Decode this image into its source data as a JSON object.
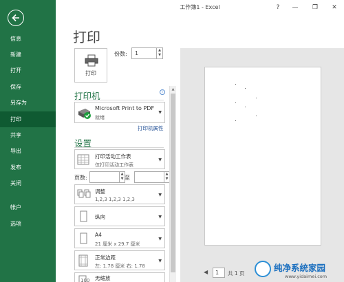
{
  "window": {
    "title": "工作簿1 - Excel",
    "help": "?",
    "minimize": "—",
    "restore": "❐",
    "close": "✕"
  },
  "nav": {
    "items": [
      "信息",
      "新建",
      "打开",
      "保存",
      "另存为",
      "打印",
      "共享",
      "导出",
      "发布",
      "关闭",
      "帐户",
      "选项"
    ],
    "active": "打印"
  },
  "page": {
    "title": "打印"
  },
  "print": {
    "button_label": "打印",
    "copies_label": "份数:",
    "copies_value": "1"
  },
  "printer": {
    "section_title": "打印机",
    "name": "Microsoft Print to PDF",
    "status": "就绪",
    "properties_link": "打印机属性",
    "info": "i"
  },
  "settings": {
    "section_title": "设置",
    "scope": {
      "main": "打印活动工作表",
      "sub": "仅打印活动工作表"
    },
    "pages_label": "页数:",
    "pages_to": "至",
    "collate": {
      "main": "调整",
      "sub": "1,2,3    1,2,3    1,2,3"
    },
    "orientation": {
      "main": "纵向"
    },
    "paper": {
      "main": "A4",
      "sub": "21 厘米 x 29.7 厘米"
    },
    "margins": {
      "main": "正常边距",
      "sub": "左: 1.78 厘米    右: 1.78"
    },
    "scaling": {
      "main": "无缩放"
    }
  },
  "preview": {
    "current_page": "1",
    "total": "共 1 页",
    "prev": "◀"
  },
  "watermark": {
    "title": "纯净系统家园",
    "url": "www.yidaimei.com"
  }
}
